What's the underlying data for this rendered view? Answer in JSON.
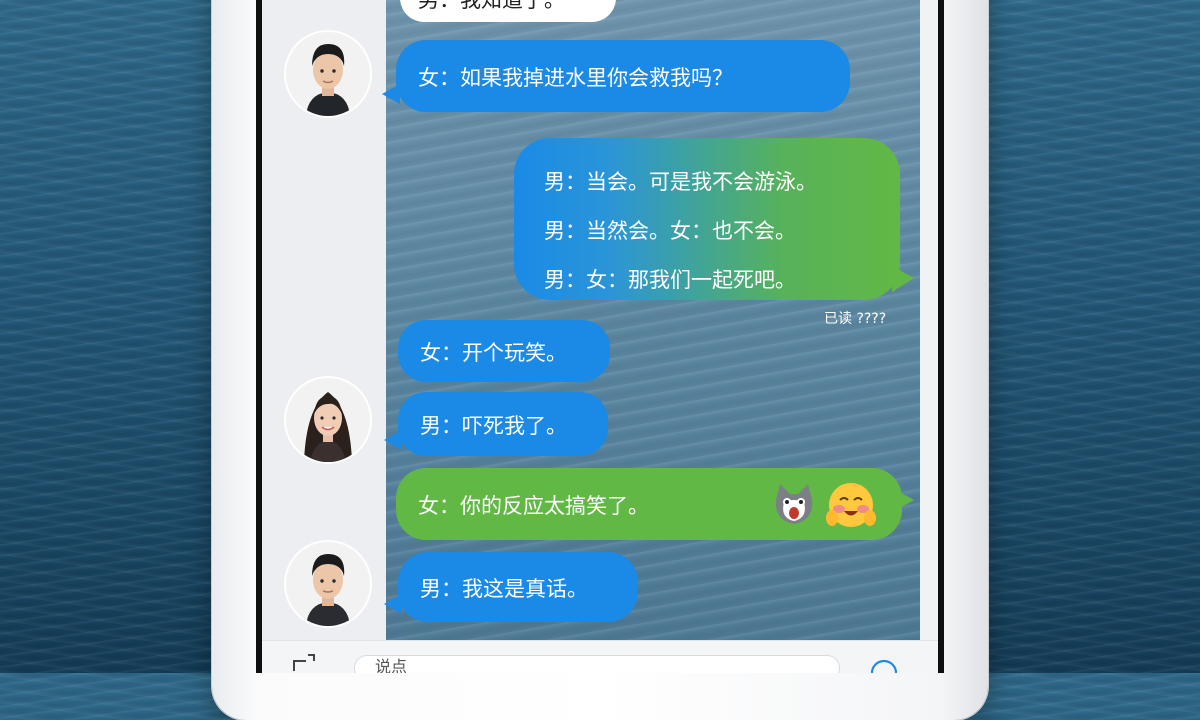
{
  "messages": [
    {
      "id": "m0",
      "text": "男：我知道了。"
    },
    {
      "id": "m1",
      "text": "女：如果我掉进水里你会救我吗？"
    },
    {
      "id": "m2",
      "lines": [
        "男：当会。可是我不会游泳。",
        "男：当然会。女：也不会。",
        "男：女：那我们一起死吧。"
      ]
    },
    {
      "id": "m3",
      "text": "女：开个玩笑。"
    },
    {
      "id": "m4",
      "text": "男：吓死我了。"
    },
    {
      "id": "m5",
      "text": "女：你的反应太搞笑了。"
    },
    {
      "id": "m6",
      "text": "男：我这是真话。"
    }
  ],
  "status_text": "已读 ????",
  "input": {
    "value": "说点"
  },
  "colors": {
    "bubble_blue": "#1a8ae6",
    "bubble_green": "#62b845",
    "chat_background": "#5d88a2",
    "ocean": "#245a7a"
  },
  "avatars": [
    {
      "id": "a1",
      "icon": "male-avatar-icon"
    },
    {
      "id": "a2",
      "icon": "female-avatar-icon"
    },
    {
      "id": "a3",
      "icon": "male-avatar-icon"
    }
  ],
  "icons": [
    "cat-face-emoji-icon",
    "blushing-face-emoji-icon",
    "attachment-icon",
    "emoji-button-icon"
  ]
}
